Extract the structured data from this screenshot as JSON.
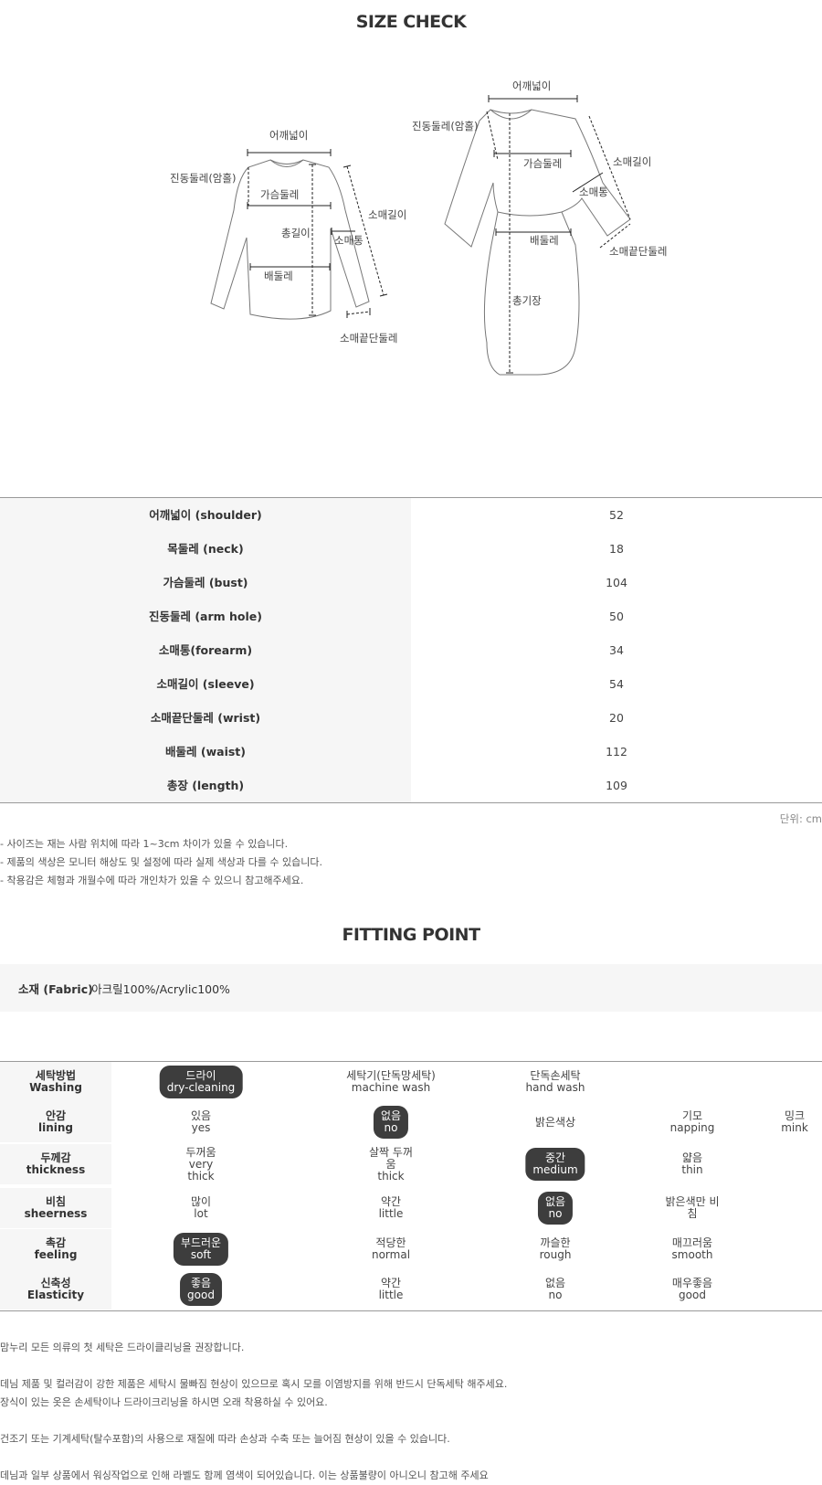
{
  "size_check": {
    "title": "SIZE CHECK",
    "diagram": {
      "top_labels": {
        "shoulder": "어깨넓이",
        "armhole": "진동둘레(암홀)",
        "bust": "가슴둘레",
        "length": "총길이",
        "forearm": "소매통",
        "sleeve": "소매길이",
        "waist": "배둘레",
        "wrist": "소매끝단둘레"
      },
      "dress_labels": {
        "shoulder": "어깨넓이",
        "armhole": "진동둘레(암홀)",
        "bust": "가슴둘레",
        "sleeve": "소매길이",
        "forearm": "소매통",
        "waist": "배둘레",
        "wrist": "소매끝단둘레",
        "total_length": "총기장"
      }
    },
    "rows": [
      {
        "label": "어깨넓이 (shoulder)",
        "value": "52"
      },
      {
        "label": "목둘레 (neck)",
        "value": "18"
      },
      {
        "label": "가슴둘레 (bust)",
        "value": "104"
      },
      {
        "label": "진동둘레 (arm hole)",
        "value": "50"
      },
      {
        "label": "소매통(forearm)",
        "value": "34"
      },
      {
        "label": "소매길이 (sleeve)",
        "value": "54"
      },
      {
        "label": "소매끝단둘레 (wrist)",
        "value": "20"
      },
      {
        "label": "배둘레 (waist)",
        "value": "112"
      },
      {
        "label": "총장 (length)",
        "value": "109"
      }
    ],
    "unit": "단위: cm",
    "notes": [
      "- 사이즈는 재는 사람 위치에 따라 1~3cm 차이가 있을 수 있습니다.",
      "- 제품의 색상은 모니터 해상도 및 설정에 따라 실제 색상과 다를 수 있습니다.",
      "- 착용감은 체형과 개월수에 따라 개인차가 있을 수 있으니 참고해주세요."
    ]
  },
  "fitting": {
    "title": "FITTING POINT",
    "fabric_label": "소재 (Fabric)",
    "fabric_value": ": 아크릴100%/Acrylic100%",
    "rows": [
      {
        "ko": "세탁방법",
        "en": "Washing",
        "options": [
          {
            "ko": "드라이",
            "en": "dry-cleaning",
            "selected": true
          },
          {
            "ko": "세탁기(단독망세탁)",
            "en": "machine wash",
            "selected": false
          },
          {
            "ko": "단독손세탁",
            "en": "hand wash",
            "selected": false
          }
        ]
      },
      {
        "ko": "안감",
        "en": "lining",
        "options": [
          {
            "ko": "있음",
            "en": "yes",
            "selected": false
          },
          {
            "ko": "없음",
            "en": "no",
            "selected": true
          },
          {
            "ko": "밝은색상",
            "en": "",
            "selected": false
          },
          {
            "ko": "기모",
            "en": "napping",
            "selected": false
          },
          {
            "ko": "밍크",
            "en": "mink",
            "selected": false
          }
        ]
      },
      {
        "ko": "두께감",
        "en": "thickness",
        "options": [
          {
            "ko": "두꺼움",
            "en": "very\nthick",
            "selected": false
          },
          {
            "ko": "살짝 두꺼\n움",
            "en": "thick",
            "selected": false
          },
          {
            "ko": "중간",
            "en": "medium",
            "selected": true
          },
          {
            "ko": "얇음",
            "en": "thin",
            "selected": false
          }
        ]
      },
      {
        "ko": "비침",
        "en": "sheerness",
        "options": [
          {
            "ko": "많이",
            "en": "lot",
            "selected": false
          },
          {
            "ko": "약간",
            "en": "little",
            "selected": false
          },
          {
            "ko": "없음",
            "en": "no",
            "selected": true
          },
          {
            "ko": "밝은색만 비\n침",
            "en": "",
            "selected": false
          }
        ]
      },
      {
        "ko": "촉감",
        "en": "feeling",
        "options": [
          {
            "ko": "부드러운",
            "en": "soft",
            "selected": true
          },
          {
            "ko": "적당한",
            "en": "normal",
            "selected": false
          },
          {
            "ko": "까슬한",
            "en": "rough",
            "selected": false
          },
          {
            "ko": "매끄러움",
            "en": "smooth",
            "selected": false
          }
        ]
      },
      {
        "ko": "신축성",
        "en": "Elasticity",
        "options": [
          {
            "ko": "좋음",
            "en": "good",
            "selected": true
          },
          {
            "ko": "약간",
            "en": "little",
            "selected": false
          },
          {
            "ko": "없음",
            "en": "no",
            "selected": false
          },
          {
            "ko": "매우좋음",
            "en": "good",
            "selected": false
          }
        ]
      }
    ],
    "paragraphs": [
      "맘누리 모든 의류의 첫 세탁은 드라이클리닝을 권장합니다.",
      "데님 제품 및 컬러감이 강한 제품은 세탁시 물빠짐 현상이 있으므로 혹시 모를 이염방지를 위해 반드시 단독세탁 해주세요.",
      "장식이 있는 옷은 손세탁이나 드라이크리닝을 하시면 오래 착용하실 수 있어요.",
      "건조기 또는 기계세탁(탈수포함)의 사용으로 재질에 따라 손상과 수축 또는 늘어짐 현상이 있을 수 있습니다.",
      "데님과 일부 상품에서 워싱작업으로 인해 라벨도 함께 염색이 되어있습니다. 이는 상품불량이 아니오니 참고해 주세요"
    ]
  }
}
